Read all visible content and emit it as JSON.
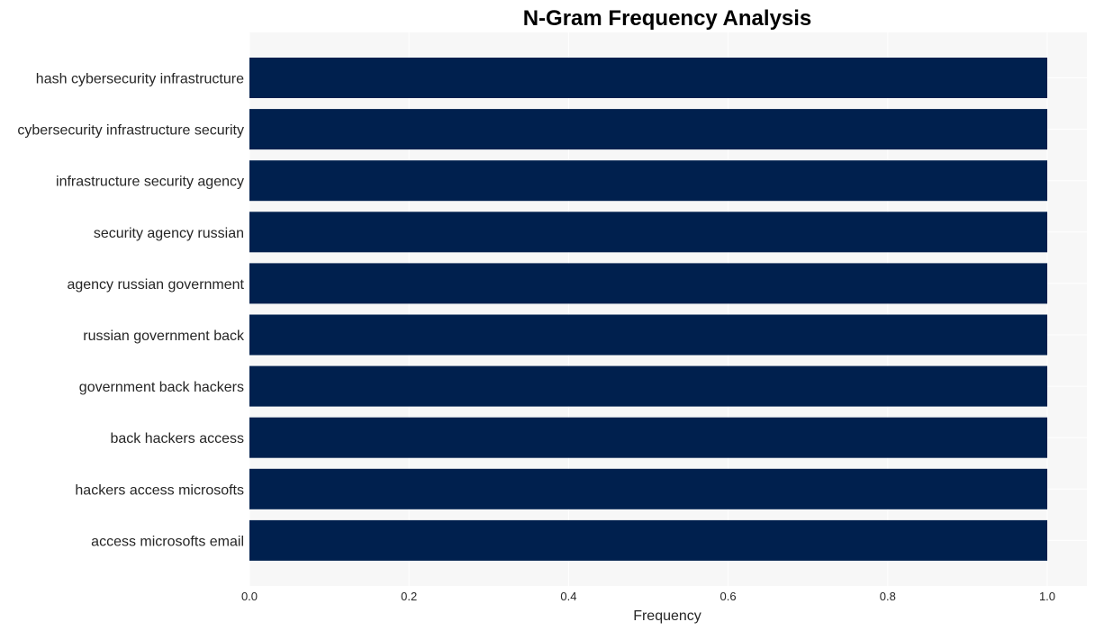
{
  "chart_data": {
    "type": "bar",
    "orientation": "horizontal",
    "title": "N-Gram Frequency Analysis",
    "xlabel": "Frequency",
    "ylabel": "",
    "categories": [
      "hash cybersecurity infrastructure",
      "cybersecurity infrastructure security",
      "infrastructure security agency",
      "security agency russian",
      "agency russian government",
      "russian government back",
      "government back hackers",
      "back hackers access",
      "hackers access microsofts",
      "access microsofts email"
    ],
    "values": [
      1,
      1,
      1,
      1,
      1,
      1,
      1,
      1,
      1,
      1
    ],
    "xlim": [
      0,
      1.05
    ],
    "xticks": [
      0.0,
      0.2,
      0.4,
      0.6,
      0.8,
      1.0
    ],
    "xtick_labels": [
      "0.0",
      "0.2",
      "0.4",
      "0.6",
      "0.8",
      "1.0"
    ],
    "grid": true,
    "legend": "none",
    "colors": {
      "bar": "#00204e",
      "plot_background": "#f7f7f7",
      "grid": "#ffffff"
    }
  }
}
